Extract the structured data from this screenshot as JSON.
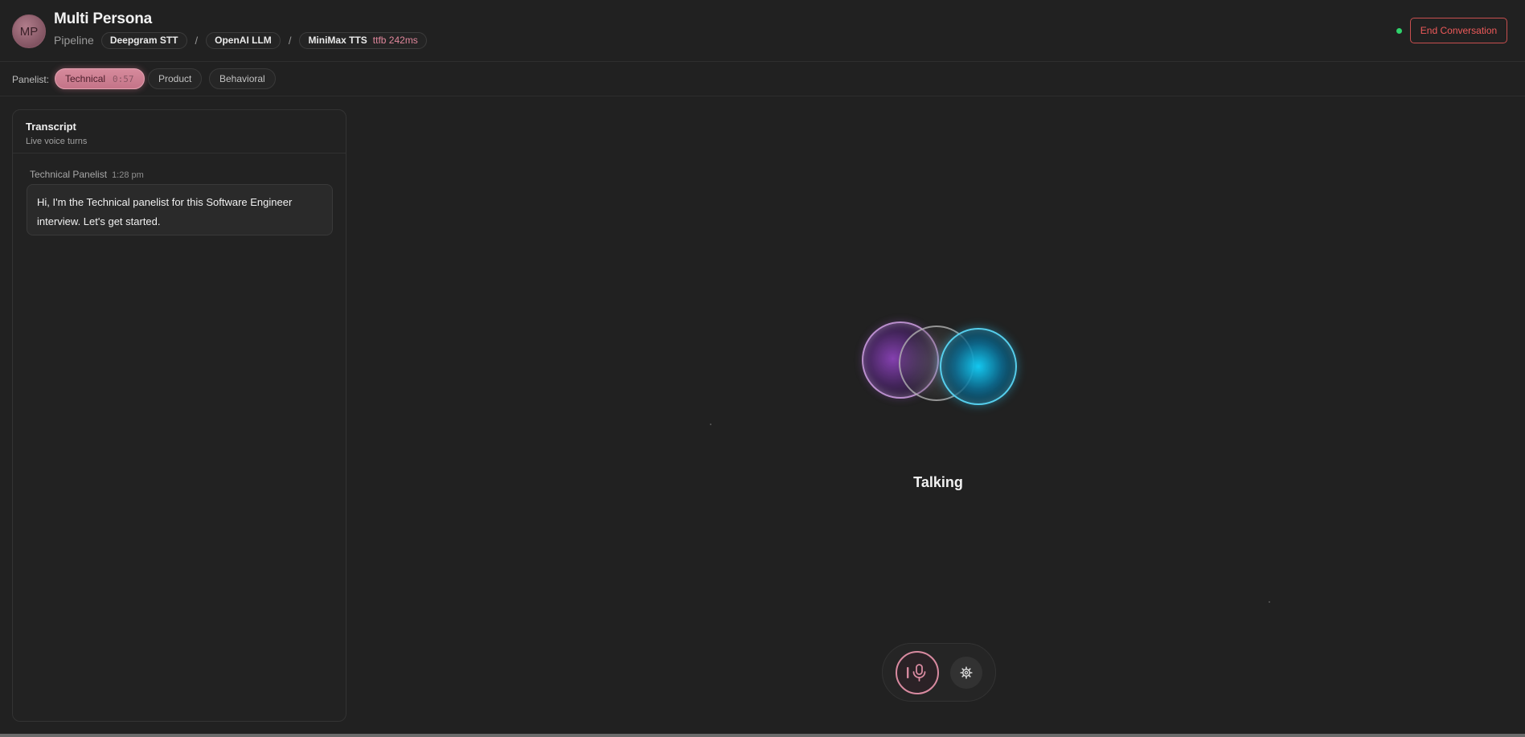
{
  "header": {
    "avatar_initials": "MP",
    "title": "Multi Persona",
    "pipeline_label": "Pipeline",
    "stt": "Deepgram STT",
    "llm": "OpenAI LLM",
    "tts": "MiniMax TTS",
    "ttfb": "ttfb 242ms",
    "separator": "/",
    "end_button": "End Conversation",
    "status_color": "#2fd16b"
  },
  "panelists": {
    "label": "Panelist:",
    "tabs": [
      {
        "label": "Technical",
        "timer": "0:57",
        "active": true
      },
      {
        "label": "Product",
        "active": false
      },
      {
        "label": "Behavioral",
        "active": false
      }
    ]
  },
  "transcript": {
    "title": "Transcript",
    "subtitle": "Live voice turns",
    "messages": [
      {
        "speaker": "Technical Panelist",
        "time": "1:28 pm",
        "text": "Hi, I'm the Technical panelist for this Software Engineer interview. Let's get started."
      }
    ]
  },
  "main": {
    "status": "Talking"
  },
  "controls": {
    "mic_icon": "microphone-icon",
    "settings_icon": "gear-icon"
  },
  "colors": {
    "accent": "#d88aa0",
    "danger": "#ee5a5a",
    "background": "#212121"
  }
}
